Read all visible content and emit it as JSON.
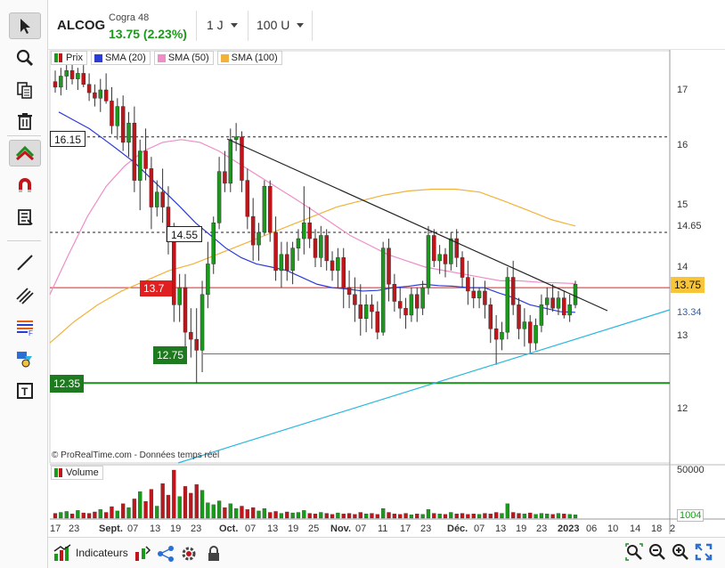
{
  "header": {
    "symbol": "ALCOG",
    "exchange": "Cogra 48",
    "price_change": "13.75 (2.23%)",
    "timeframe": "1 J",
    "units": "100 U"
  },
  "legend": [
    {
      "label": "Prix",
      "color": "#1a9a1a"
    },
    {
      "label": "SMA (20)",
      "color": "#2b3bd6"
    },
    {
      "label": "SMA (50)",
      "color": "#f08cc8"
    },
    {
      "label": "SMA (100)",
      "color": "#f2b23a"
    }
  ],
  "volume_legend": "Volume",
  "copyright": "© ProRealTime.com - Données temps réel",
  "price_axis": [
    "17",
    "16",
    "15",
    "14",
    "13",
    "12"
  ],
  "volume_axis": {
    "max": "50000",
    "last": "1004"
  },
  "levels": {
    "l1615": "16.15",
    "l1465": "14.65",
    "l1455": "14.55",
    "l1375": "13.75",
    "l137": "13.7",
    "l1334": "13.34",
    "l1275": "12.75",
    "l1235": "12.35"
  },
  "time_axis": [
    "17",
    "23",
    "Sept.",
    "07",
    "13",
    "19",
    "23",
    "Oct.",
    "07",
    "13",
    "19",
    "25",
    "Nov.",
    "07",
    "11",
    "17",
    "23",
    "Déc.",
    "07",
    "13",
    "19",
    "23",
    "2023",
    "06",
    "10",
    "14",
    "18",
    "2"
  ],
  "bottom": {
    "indicators_label": "Indicateurs"
  },
  "colors": {
    "up": "#1a9a1a",
    "down": "#c0161b",
    "sma20": "#2b3bd6",
    "sma50": "#f08cc8",
    "sma100": "#f2b23a",
    "support": "#2bb7e0",
    "resistance_red": "#e02020",
    "green_level": "#1e8c1e",
    "last_price": "#f7c43a"
  },
  "chart_data": {
    "type": "candlestick",
    "price_range": [
      11.5,
      17.5
    ],
    "candles": [
      [
        17.15,
        17.35,
        16.95,
        17.05
      ],
      [
        17.05,
        17.4,
        16.9,
        17.25
      ],
      [
        17.25,
        17.45,
        17.0,
        17.35
      ],
      [
        17.35,
        17.5,
        17.1,
        17.2
      ],
      [
        17.2,
        17.4,
        17.0,
        17.3
      ],
      [
        17.3,
        17.45,
        17.05,
        17.1
      ],
      [
        17.1,
        17.3,
        16.8,
        16.95
      ],
      [
        16.95,
        17.1,
        16.7,
        16.85
      ],
      [
        16.85,
        17.2,
        16.6,
        17.0
      ],
      [
        17.0,
        17.3,
        16.75,
        16.8
      ],
      [
        16.8,
        17.05,
        16.2,
        16.35
      ],
      [
        16.35,
        16.85,
        16.1,
        16.7
      ],
      [
        16.7,
        16.9,
        15.9,
        16.05
      ],
      [
        16.05,
        16.6,
        15.8,
        16.4
      ],
      [
        16.4,
        16.7,
        15.2,
        15.4
      ],
      [
        15.4,
        16.1,
        14.9,
        15.9
      ],
      [
        15.9,
        16.3,
        15.4,
        15.6
      ],
      [
        15.6,
        15.8,
        14.6,
        14.95
      ],
      [
        14.95,
        15.4,
        14.8,
        15.2
      ],
      [
        15.2,
        15.6,
        14.7,
        14.95
      ],
      [
        14.95,
        15.3,
        14.2,
        14.4
      ],
      [
        14.4,
        14.7,
        13.2,
        13.45
      ],
      [
        13.45,
        13.9,
        13.2,
        13.7
      ],
      [
        13.7,
        13.9,
        12.75,
        13.05
      ],
      [
        13.05,
        13.4,
        12.7,
        12.95
      ],
      [
        12.95,
        13.4,
        12.35,
        12.8
      ],
      [
        12.8,
        13.8,
        12.5,
        13.6
      ],
      [
        13.6,
        14.4,
        13.4,
        14.05
      ],
      [
        14.05,
        14.8,
        13.9,
        14.7
      ],
      [
        14.7,
        15.8,
        14.6,
        15.55
      ],
      [
        15.55,
        15.9,
        15.2,
        15.35
      ],
      [
        15.35,
        16.3,
        15.2,
        16.1
      ],
      [
        16.1,
        16.4,
        15.9,
        16.15
      ],
      [
        16.15,
        16.25,
        15.2,
        15.4
      ],
      [
        15.4,
        15.6,
        14.6,
        14.8
      ],
      [
        14.8,
        15.1,
        14.1,
        14.35
      ],
      [
        14.35,
        14.7,
        14.1,
        14.55
      ],
      [
        14.55,
        15.4,
        14.5,
        15.3
      ],
      [
        15.3,
        15.4,
        14.4,
        14.55
      ],
      [
        14.55,
        14.8,
        13.8,
        13.95
      ],
      [
        13.95,
        14.4,
        13.7,
        14.2
      ],
      [
        14.2,
        14.4,
        13.8,
        13.95
      ],
      [
        13.95,
        14.4,
        13.75,
        14.3
      ],
      [
        14.3,
        14.6,
        14.1,
        14.45
      ],
      [
        14.45,
        15.3,
        14.2,
        14.7
      ],
      [
        14.7,
        14.95,
        14.3,
        14.45
      ],
      [
        14.45,
        14.6,
        14.0,
        14.15
      ],
      [
        14.15,
        14.65,
        14.0,
        14.5
      ],
      [
        14.5,
        14.6,
        13.95,
        14.1
      ],
      [
        14.1,
        14.25,
        13.8,
        13.95
      ],
      [
        13.95,
        14.3,
        13.7,
        14.15
      ],
      [
        14.15,
        14.3,
        13.4,
        13.7
      ],
      [
        13.7,
        13.95,
        13.4,
        13.6
      ],
      [
        13.6,
        13.85,
        13.2,
        13.45
      ],
      [
        13.45,
        13.75,
        13.0,
        13.25
      ],
      [
        13.25,
        13.6,
        13.05,
        13.45
      ],
      [
        13.45,
        13.6,
        13.1,
        13.35
      ],
      [
        13.35,
        13.5,
        12.95,
        13.05
      ],
      [
        13.05,
        14.4,
        13.0,
        14.3
      ],
      [
        14.3,
        14.45,
        13.5,
        13.75
      ],
      [
        13.75,
        13.9,
        13.35,
        13.5
      ],
      [
        13.5,
        13.7,
        13.25,
        13.4
      ],
      [
        13.4,
        13.55,
        13.1,
        13.3
      ],
      [
        13.3,
        13.7,
        13.2,
        13.6
      ],
      [
        13.6,
        13.7,
        13.2,
        13.4
      ],
      [
        13.4,
        13.8,
        13.3,
        13.7
      ],
      [
        13.7,
        14.65,
        13.6,
        14.5
      ],
      [
        14.5,
        14.6,
        14.0,
        14.1
      ],
      [
        14.1,
        14.35,
        13.9,
        14.2
      ],
      [
        14.2,
        14.3,
        13.85,
        14.05
      ],
      [
        14.05,
        14.55,
        13.95,
        14.45
      ],
      [
        14.45,
        14.6,
        14.0,
        14.15
      ],
      [
        14.15,
        14.25,
        13.7,
        13.85
      ],
      [
        13.85,
        14.1,
        13.45,
        13.65
      ],
      [
        13.65,
        13.85,
        13.4,
        13.55
      ],
      [
        13.55,
        13.7,
        13.4,
        13.65
      ],
      [
        13.65,
        13.8,
        13.25,
        13.45
      ],
      [
        13.45,
        13.55,
        12.9,
        13.1
      ],
      [
        13.1,
        13.3,
        12.6,
        12.95
      ],
      [
        12.95,
        13.2,
        12.8,
        13.05
      ],
      [
        13.05,
        14.0,
        12.95,
        13.85
      ],
      [
        13.85,
        14.1,
        13.3,
        13.45
      ],
      [
        13.45,
        13.55,
        12.95,
        13.1
      ],
      [
        13.1,
        13.4,
        12.85,
        13.2
      ],
      [
        13.2,
        13.3,
        12.75,
        12.9
      ],
      [
        12.9,
        13.25,
        12.8,
        13.15
      ],
      [
        13.15,
        13.6,
        13.05,
        13.45
      ],
      [
        13.45,
        13.7,
        13.3,
        13.55
      ],
      [
        13.55,
        13.75,
        13.35,
        13.4
      ],
      [
        13.4,
        13.65,
        13.3,
        13.55
      ],
      [
        13.55,
        13.65,
        13.25,
        13.3
      ],
      [
        13.3,
        13.6,
        13.2,
        13.45
      ],
      [
        13.45,
        13.8,
        13.4,
        13.75
      ]
    ],
    "sma20": [
      16.6,
      16.45,
      16.3,
      16.1,
      15.9,
      15.7,
      15.45,
      15.2,
      14.95,
      14.7,
      14.5,
      14.3,
      14.15,
      14.05,
      14.0,
      13.95,
      13.85,
      13.75,
      13.7,
      13.68,
      13.65,
      13.66,
      13.7,
      13.72,
      13.75,
      13.73,
      13.72,
      13.7,
      13.7,
      13.62,
      13.55,
      13.45,
      13.4,
      13.35,
      13.34
    ],
    "sma50": [
      13.6,
      14.2,
      14.8,
      15.3,
      15.65,
      15.9,
      16.05,
      16.1,
      16.05,
      15.9,
      15.7,
      15.5,
      15.3,
      15.1,
      14.9,
      14.7,
      14.5,
      14.35,
      14.2,
      14.1,
      14.0,
      13.95,
      13.9,
      13.85,
      13.8,
      13.8,
      13.78,
      13.77,
      13.76
    ],
    "sma100": [
      12.9,
      13.2,
      13.45,
      13.65,
      13.8,
      13.95,
      14.05,
      14.2,
      14.35,
      14.5,
      14.65,
      14.8,
      14.95,
      15.05,
      15.15,
      15.22,
      15.25,
      15.25,
      15.2,
      15.05,
      14.9,
      14.75,
      14.65
    ],
    "volume": [
      0.1,
      0.12,
      0.14,
      0.09,
      0.16,
      0.11,
      0.1,
      0.13,
      0.18,
      0.12,
      0.24,
      0.15,
      0.3,
      0.22,
      0.4,
      0.55,
      0.35,
      0.6,
      0.25,
      0.72,
      0.48,
      1.0,
      0.45,
      0.66,
      0.52,
      0.7,
      0.58,
      0.32,
      0.28,
      0.36,
      0.22,
      0.3,
      0.2,
      0.25,
      0.18,
      0.22,
      0.15,
      0.2,
      0.12,
      0.14,
      0.1,
      0.13,
      0.11,
      0.12,
      0.16,
      0.1,
      0.09,
      0.12,
      0.1,
      0.08,
      0.11,
      0.09,
      0.1,
      0.08,
      0.12,
      0.09,
      0.1,
      0.08,
      0.2,
      0.12,
      0.09,
      0.08,
      0.1,
      0.07,
      0.09,
      0.08,
      0.18,
      0.1,
      0.09,
      0.08,
      0.12,
      0.09,
      0.1,
      0.08,
      0.09,
      0.08,
      0.1,
      0.09,
      0.12,
      0.1,
      0.3,
      0.12,
      0.1,
      0.09,
      0.11,
      0.08,
      0.1,
      0.09,
      0.08,
      0.1,
      0.09,
      0.08,
      0.07
    ]
  }
}
